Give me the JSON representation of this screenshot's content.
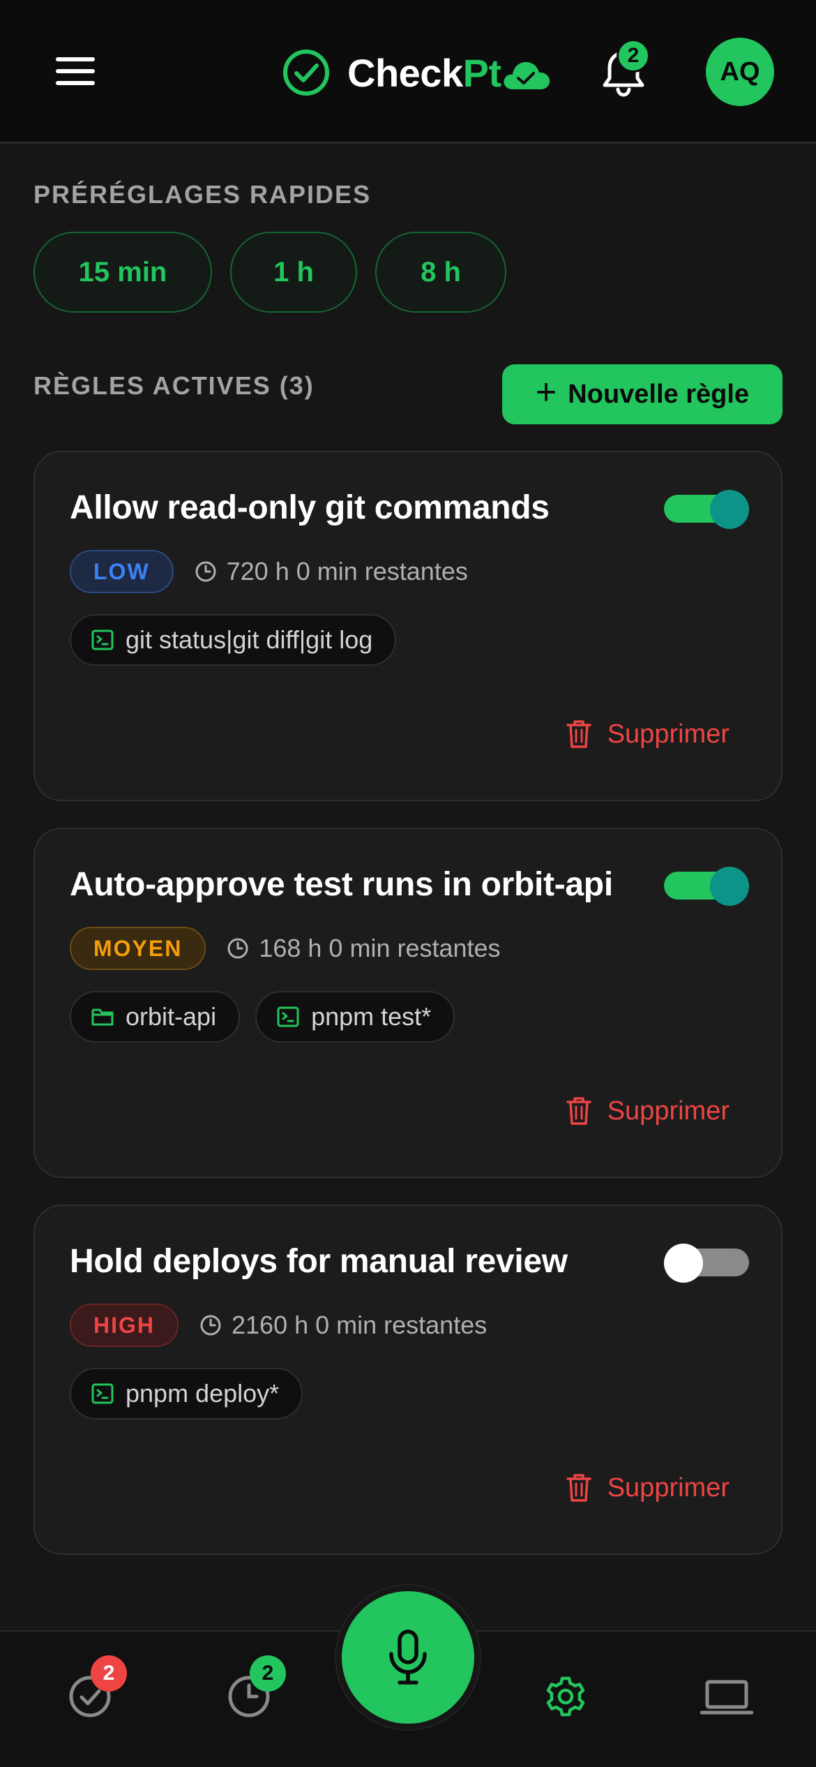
{
  "header": {
    "brand_prefix": "Check",
    "brand_suffix": "Pt",
    "notification_count": "2",
    "avatar_initials": "AQ"
  },
  "presets": {
    "label": "PRÉRÉGLAGES RAPIDES",
    "items": [
      "15 min",
      "1 h",
      "8 h"
    ]
  },
  "rules": {
    "label": "RÈGLES ACTIVES (3)",
    "new_rule_label": "Nouvelle règle",
    "delete_label": "Supprimer",
    "items": [
      {
        "title": "Allow read-only git commands",
        "enabled": true,
        "level": "LOW",
        "remaining": "720 h 0 min restantes",
        "chips": [
          {
            "icon": "terminal-icon",
            "text": "git status|git diff|git log"
          }
        ]
      },
      {
        "title": "Auto-approve test runs in orbit-api",
        "enabled": true,
        "level": "MOYEN",
        "remaining": "168 h 0 min restantes",
        "chips": [
          {
            "icon": "folder-icon",
            "text": "orbit-api"
          },
          {
            "icon": "terminal-icon",
            "text": "pnpm test*"
          }
        ]
      },
      {
        "title": "Hold deploys for manual review",
        "enabled": false,
        "level": "HIGH",
        "remaining": "2160 h 0 min restantes",
        "chips": [
          {
            "icon": "terminal-icon",
            "text": "pnpm deploy*"
          }
        ]
      }
    ]
  },
  "bottom_nav": {
    "approvals_badge": "2",
    "history_badge": "2",
    "items": [
      "check-circle-icon",
      "clock-icon",
      "microphone-icon",
      "gear-icon",
      "laptop-icon"
    ]
  },
  "colors": {
    "accent": "#22c55e",
    "danger": "#ef4444",
    "warning": "#f59e0b",
    "info": "#3b82f6",
    "toggle_knob_on": "#0d9488",
    "background": "#161616"
  }
}
